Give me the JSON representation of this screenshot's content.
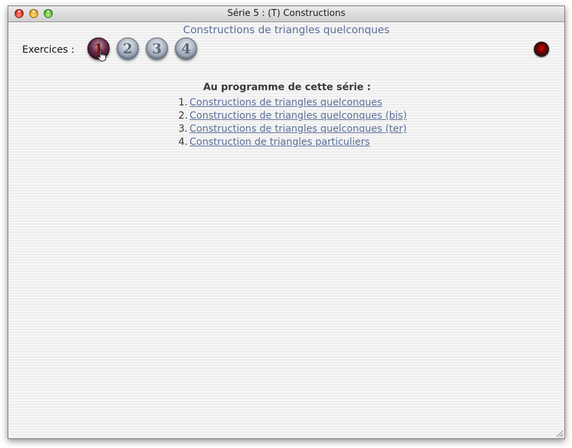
{
  "window": {
    "title": "Série 5 : (T) Constructions"
  },
  "header": {
    "heading": "Constructions de triangles quelconques",
    "exercices_label": "Exercices :",
    "exercise_buttons": [
      {
        "label": "1",
        "active": true
      },
      {
        "label": "2",
        "active": false
      },
      {
        "label": "3",
        "active": false
      },
      {
        "label": "4",
        "active": false
      }
    ]
  },
  "programme": {
    "title": "Au programme de cette série :",
    "items": [
      {
        "number": "1.",
        "label": "Constructions de triangles quelconques"
      },
      {
        "number": "2.",
        "label": "Constructions de triangles quelconques (bis)"
      },
      {
        "number": "3.",
        "label": "Constructions de triangles quelconques (ter)"
      },
      {
        "number": "4.",
        "label": "Construction de triangles particuliers"
      }
    ]
  },
  "icons": {
    "close": "close-icon",
    "minimize": "minimize-icon",
    "zoom": "zoom-icon",
    "cursor": "hand-cursor-icon",
    "stop": "stop-icon",
    "resize": "resize-grip-icon"
  },
  "colors": {
    "link": "#5b6f98",
    "heading": "#5b6f98",
    "active_button": "#6a2a48",
    "stop_button": "#c21010"
  }
}
